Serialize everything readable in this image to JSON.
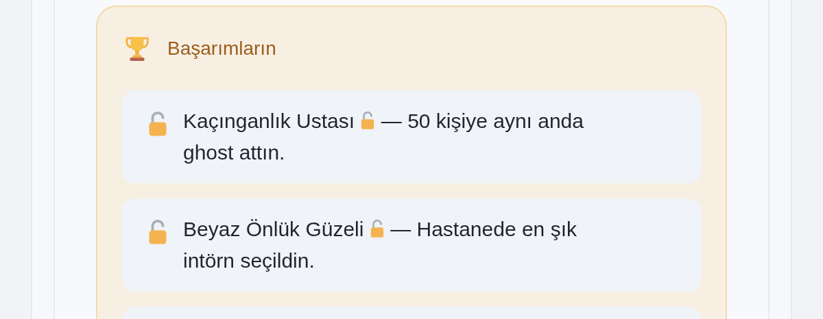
{
  "achievements": {
    "title": "Başarımların",
    "items": [
      {
        "title": "Kaçınganlık Ustası",
        "separator": "—",
        "description": "50 kişiye aynı anda ghost attın.",
        "unlocked": true
      },
      {
        "title": "Beyaz Önlük Güzeli",
        "separator": "—",
        "description": "Hastanede en şık intörn seçildin.",
        "unlocked": true
      }
    ]
  }
}
